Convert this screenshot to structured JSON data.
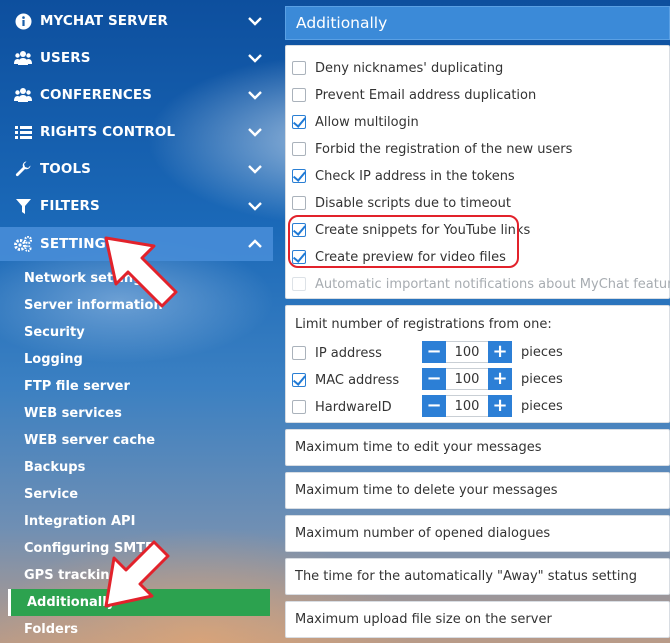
{
  "sidebar": {
    "menu": [
      {
        "label": "MYCHAT SERVER",
        "icon": "info-icon"
      },
      {
        "label": "USERS",
        "icon": "users-icon"
      },
      {
        "label": "CONFERENCES",
        "icon": "conferences-icon"
      },
      {
        "label": "RIGHTS CONTROL",
        "icon": "list-icon"
      },
      {
        "label": "TOOLS",
        "icon": "wrench-icon"
      },
      {
        "label": "FILTERS",
        "icon": "filter-icon"
      },
      {
        "label": "SETTINGS",
        "icon": "gears-icon"
      }
    ],
    "submenu": [
      "Network settings",
      "Server information",
      "Security",
      "Logging",
      "FTP file server",
      "WEB services",
      "WEB server cache",
      "Backups",
      "Service",
      "Integration API",
      "Configuring SMTP",
      "GPS tracking",
      "Additionally",
      "Folders"
    ],
    "active_submenu": "Additionally",
    "active_color": "#2ca24f"
  },
  "panel": {
    "title": "Additionally",
    "options": [
      {
        "label": "Deny nicknames' duplicating",
        "checked": false,
        "disabled": false
      },
      {
        "label": "Prevent Email address duplication",
        "checked": false,
        "disabled": false
      },
      {
        "label": "Allow multilogin",
        "checked": true,
        "disabled": false
      },
      {
        "label": "Forbid the registration of the new users",
        "checked": false,
        "disabled": false
      },
      {
        "label": "Check IP address in the tokens",
        "checked": true,
        "disabled": false
      },
      {
        "label": "Disable scripts due to timeout",
        "checked": false,
        "disabled": false
      },
      {
        "label": "Create snippets for YouTube links",
        "checked": true,
        "disabled": false
      },
      {
        "label": "Create preview for video files",
        "checked": true,
        "disabled": false
      },
      {
        "label": "Automatic important notifications about MyChat features",
        "checked": false,
        "disabled": true
      }
    ],
    "registration": {
      "title": "Limit number of registrations from one:",
      "rows": [
        {
          "label": "IP address",
          "checked": false,
          "value": "100",
          "unit": "pieces"
        },
        {
          "label": "MAC address",
          "checked": true,
          "value": "100",
          "unit": "pieces"
        },
        {
          "label": "HardwareID",
          "checked": false,
          "value": "100",
          "unit": "pieces"
        }
      ]
    },
    "sections": [
      "Maximum time to edit your messages",
      "Maximum time to delete your messages",
      "Maximum number of opened dialogues",
      "The time for the automatically \"Away\" status setting",
      "Maximum upload file size on the server"
    ],
    "accent_color": "#2c7fd6",
    "header_color": "#3b8ad8"
  }
}
